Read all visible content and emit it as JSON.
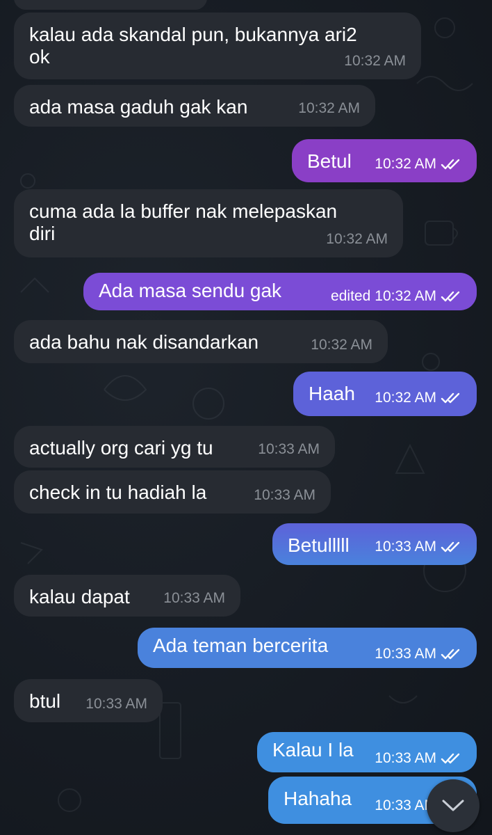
{
  "messages": [
    {
      "direction": "in",
      "text": "",
      "time": ""
    },
    {
      "direction": "in",
      "text": "kalau ada skandal pun, bukannya ari2\nok",
      "time": "10:32 AM"
    },
    {
      "direction": "in",
      "text": "ada masa gaduh gak kan",
      "time": "10:32 AM"
    },
    {
      "direction": "out",
      "text": "Betul",
      "time": "10:32 AM",
      "status": "read"
    },
    {
      "direction": "in",
      "text": "cuma ada la buffer nak melepaskan\ndiri",
      "time": "10:32 AM"
    },
    {
      "direction": "out",
      "text": "Ada masa sendu gak",
      "edited_label": "edited",
      "time": "10:32 AM",
      "status": "read"
    },
    {
      "direction": "in",
      "text": "ada bahu nak disandarkan",
      "time": "10:32 AM"
    },
    {
      "direction": "out",
      "text": "Haah",
      "time": "10:32 AM",
      "status": "read"
    },
    {
      "direction": "in",
      "text": "actually org cari yg tu",
      "time": "10:33 AM"
    },
    {
      "direction": "in",
      "text": "check in tu hadiah la",
      "time": "10:33 AM"
    },
    {
      "direction": "out",
      "text": "Betulllll",
      "time": "10:33 AM",
      "status": "read"
    },
    {
      "direction": "in",
      "text": "kalau dapat",
      "time": "10:33 AM"
    },
    {
      "direction": "out",
      "text": "Ada teman bercerita",
      "time": "10:33 AM",
      "status": "read"
    },
    {
      "direction": "in",
      "text": "btul",
      "time": "10:33 AM"
    },
    {
      "direction": "out",
      "text": "Kalau I la",
      "time": "10:33 AM",
      "status": "read"
    },
    {
      "direction": "out",
      "text": "Hahaha",
      "time": "10:33 AM",
      "status": "read"
    }
  ],
  "colors": {
    "incoming_bubble": "#272b32",
    "outgoing_gradient": [
      "#8a3fc6",
      "#7b4cd6",
      "#5d62d9",
      "#4a82dc",
      "#3f8fe0"
    ],
    "background": "#161b22"
  },
  "scroll_button": {
    "icon": "chevron-down-icon"
  }
}
